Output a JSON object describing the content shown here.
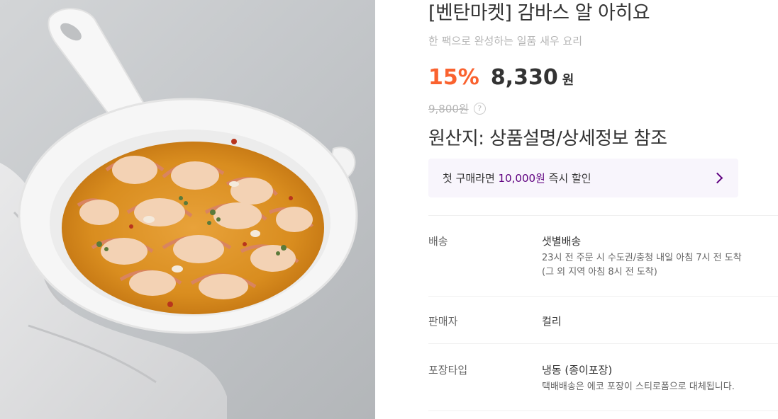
{
  "product": {
    "image_alt": "감바스 알 아히요",
    "title": "[벤탄마켓] 감바스 알 아히요",
    "subtitle": "한 팩으로 완성하는 일품 새우 요리",
    "discount": "15%",
    "price": "8,330",
    "currency": "원",
    "original_price": "9,800원",
    "help_icon": "question-circle-icon",
    "origin": "원산지: 상품설명/상세정보 참조"
  },
  "coupon": {
    "prefix": "첫 구매라면 ",
    "amount": "10,000원",
    "suffix": " 즉시 할인",
    "icon": "chevron-right-icon"
  },
  "details": {
    "delivery": {
      "label": "배송",
      "value": "샛별배송",
      "note1": "23시 전 주문 시 수도권/충청 내일 아침 7시 전 도착",
      "note2": "(그 외 지역 아침 8시 전 도착)"
    },
    "seller": {
      "label": "판매자",
      "value": "컬리"
    },
    "packaging": {
      "label": "포장타입",
      "value": "냉동 (종이포장)",
      "note1": "택배배송은 에코 포장이 스티로폼으로 대체됩니다."
    }
  },
  "colors": {
    "discount": "#fa622f",
    "brand_purple": "#5f0080",
    "coupon_bg": "#f8f5fc"
  }
}
